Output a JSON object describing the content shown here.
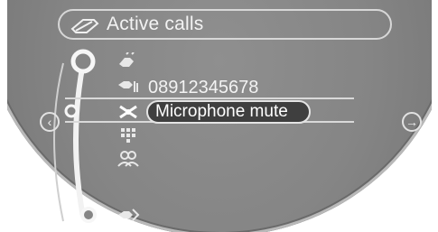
{
  "header": {
    "title": "Active calls",
    "icon": "phone-handset-icon"
  },
  "menu": {
    "items": [
      {
        "name": "hang-up",
        "icon": "hang-up-phone-icon",
        "label": ""
      },
      {
        "name": "call-number",
        "icon": "phone-signal-icon",
        "label": "08912345678"
      },
      {
        "name": "microphone-mute",
        "icon": "microphone-mute-icon",
        "label": "Microphone mute",
        "selected": true
      },
      {
        "name": "keypad",
        "icon": "keypad-icon",
        "label": ""
      },
      {
        "name": "conference",
        "icon": "people-icon",
        "label": ""
      },
      {
        "name": "transfer",
        "icon": "phone-transfer-icon",
        "label": ""
      }
    ]
  },
  "nav": {
    "left_icon": "chevron-left-icon",
    "right_icon": "arrow-right-icon"
  },
  "colors": {
    "screen_bg": "#858585",
    "text": "#f3f3f3",
    "selected_bg": "#3f3f3f",
    "border": "#e4e4e4"
  }
}
